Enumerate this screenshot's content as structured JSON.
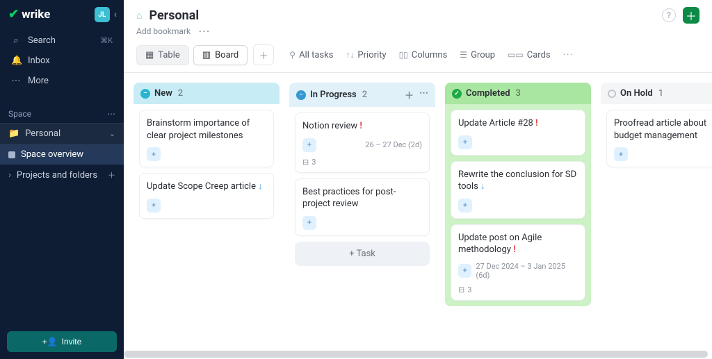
{
  "brand": "wrike",
  "user_initials": "JL",
  "sidebar": {
    "search": {
      "label": "Search",
      "shortcut": "⌘K"
    },
    "inbox_label": "Inbox",
    "more_label": "More",
    "section_label": "Space",
    "personal_label": "Personal",
    "overview_label": "Space overview",
    "projects_label": "Projects and folders",
    "invite_label": "Invite"
  },
  "header": {
    "title": "Personal",
    "add_bookmark": "Add bookmark"
  },
  "views": {
    "table": "Table",
    "board": "Board"
  },
  "toolbar": {
    "all_tasks": "All tasks",
    "priority": "Priority",
    "columns": "Columns",
    "group": "Group",
    "cards": "Cards"
  },
  "board": {
    "add_task": "+ Task",
    "columns": [
      {
        "key": "new",
        "name": "New",
        "count": "2",
        "style": "new",
        "show_actions": false,
        "cards": [
          {
            "title": "Brainstorm importance of clear project milestones",
            "assignee": true
          },
          {
            "title": "Update Scope Creep article",
            "assignee": true,
            "priority": "down"
          }
        ]
      },
      {
        "key": "inprogress",
        "name": "In Progress",
        "count": "2",
        "style": "inprog",
        "show_actions": true,
        "show_add_task": true,
        "cards": [
          {
            "title": "Notion review",
            "assignee": true,
            "priority": "high",
            "date": "26 – 27 Dec (2d)",
            "subtasks": "3"
          },
          {
            "title": "Best practices for post-project review",
            "assignee": true
          }
        ]
      },
      {
        "key": "completed",
        "name": "Completed",
        "count": "3",
        "style": "done",
        "show_actions": false,
        "done": true,
        "cards": [
          {
            "title": "Update Article #28",
            "assignee": true,
            "priority": "high"
          },
          {
            "title": "Rewrite the conclusion for SD tools",
            "assignee": true,
            "priority": "down"
          },
          {
            "title": "Update post on Agile methodology",
            "assignee": true,
            "priority": "high",
            "date": "27 Dec 2024 – 3 Jan 2025 (6d)",
            "subtasks": "3"
          }
        ]
      },
      {
        "key": "onhold",
        "name": "On Hold",
        "count": "1",
        "style": "hold",
        "show_actions": false,
        "cards": [
          {
            "title": "Proofread article about budget management",
            "assignee": true
          }
        ]
      }
    ]
  }
}
